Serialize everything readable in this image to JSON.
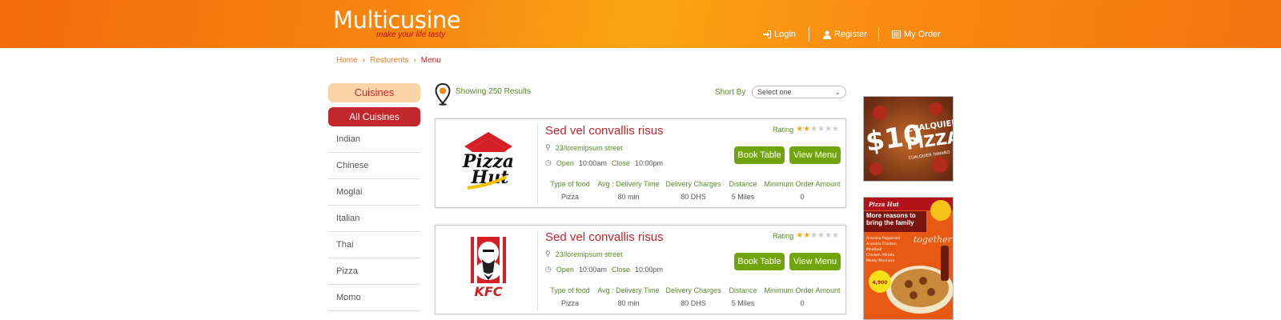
{
  "brand": {
    "name": "Multicusine",
    "tagline": "make your life tasty"
  },
  "nav": {
    "login": "Login",
    "register": "Register",
    "my_order": "My Order"
  },
  "breadcrumb": {
    "home": "Home",
    "sep": "›",
    "restaurants": "Resturents",
    "current": "Menu"
  },
  "sidebar": {
    "heading": "Cuisines",
    "all": "All Cuisines",
    "items": [
      "Indian",
      "Chinese",
      "Moglai",
      "Italian",
      "Thai",
      "Pizza",
      "Momo"
    ]
  },
  "results": {
    "text": "Showing 250 Results",
    "sort_label": "Short By",
    "sort_value": "Select one"
  },
  "cards": [
    {
      "logo": "pizza-hut-logo",
      "logo_text": [
        "Pizza",
        "Hut"
      ],
      "title": "Sed vel convallis risus",
      "rating_label": "Rating",
      "rating": 2,
      "rating_max": 6,
      "address": "23/loremipsum street",
      "open_label": "Open",
      "open_time": "10:00am",
      "close_label": "Close",
      "close_time": "10:00pm",
      "book_label": "Book Table",
      "view_label": "View Menu",
      "headers": [
        "Type of food",
        "Avg : Delivery Time",
        "Delivery Charges",
        "Distance",
        "Minimum Order Amount"
      ],
      "values": [
        "Pizza",
        "80 min",
        "80 DHS",
        "5 Miles",
        "0"
      ]
    },
    {
      "logo": "kfc-logo",
      "logo_text": [
        "KFC"
      ],
      "title": "Sed vel convallis risus",
      "rating_label": "Rating",
      "rating": 2,
      "rating_max": 6,
      "address": "23/loremipsum street",
      "open_label": "Open",
      "open_time": "10:00am",
      "close_label": "Close",
      "close_time": "10:00pm",
      "book_label": "Book Table",
      "view_label": "View Menu",
      "headers": [
        "Type of food",
        "Avg : Delivery Time",
        "Delivery Charges",
        "Distance",
        "Minimum Order Amount"
      ],
      "values": [
        "Pizza",
        "80 min",
        "80 DHS",
        "5 Miles",
        "0"
      ]
    }
  ],
  "ads": {
    "ad1": {
      "big": "$10",
      "line1": "CUALQUIER",
      "line2": "PIZZA",
      "line3": "CUALQUIER TAMAÑO"
    },
    "ad2": {
      "brand": "Pizza Hut",
      "headline": "More reasons to bring the family",
      "script": "together",
      "menu": [
        "Anatolia Pepperoni",
        "Anatolia Chicken",
        "Meatball",
        "Chicken Alfredo",
        "Meaty Marinara"
      ],
      "price": "4,900"
    }
  },
  "colors": {
    "brand_red": "#c1272d",
    "green": "#72a40e",
    "orange": "#f78410"
  }
}
